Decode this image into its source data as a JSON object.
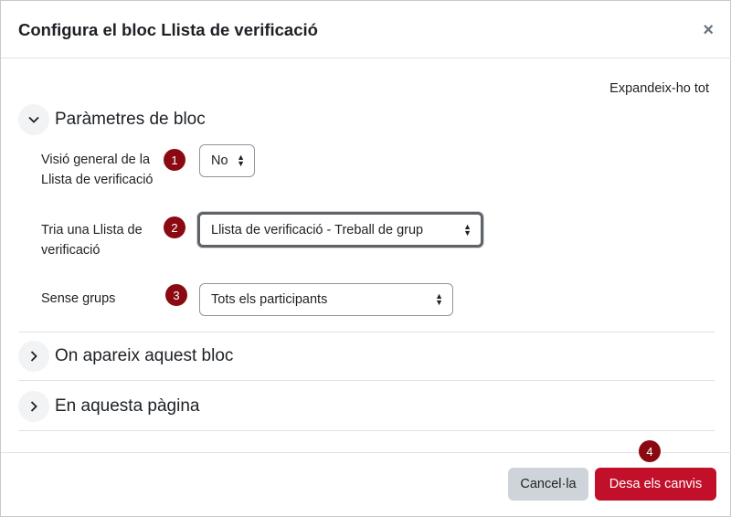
{
  "modal": {
    "title": "Configura el bloc Llista de verificació",
    "close_glyph": "×",
    "expand_all": "Expandeix-ho tot"
  },
  "sections": {
    "block_params": {
      "title": "Paràmetres de bloc",
      "state": "expanded",
      "icon": "chevron-down-icon"
    },
    "where_appears": {
      "title": "On apareix aquest bloc",
      "state": "collapsed",
      "icon": "chevron-right-icon"
    },
    "on_this_page": {
      "title": "En aquesta pàgina",
      "state": "collapsed",
      "icon": "chevron-right-icon"
    }
  },
  "fields": {
    "overview": {
      "label_line1": "Visió general de la",
      "label_line2": "Llista de verificació",
      "value": "No",
      "badge": "1"
    },
    "choose_checklist": {
      "label_line1": "Tria una Llista de",
      "label_line2": "verificació",
      "value": "Llista de verificació - Treball de grup",
      "badge": "2"
    },
    "groups": {
      "label": "Sense grups",
      "value": "Tots els participants",
      "badge": "3"
    }
  },
  "footer": {
    "cancel_label": "Cancel·la",
    "save_label": "Desa els canvis",
    "save_badge": "4"
  },
  "colors": {
    "badge": "#8b0a12",
    "primary": "#c3102a",
    "secondary": "#ced4da",
    "border": "#dee2e6"
  }
}
